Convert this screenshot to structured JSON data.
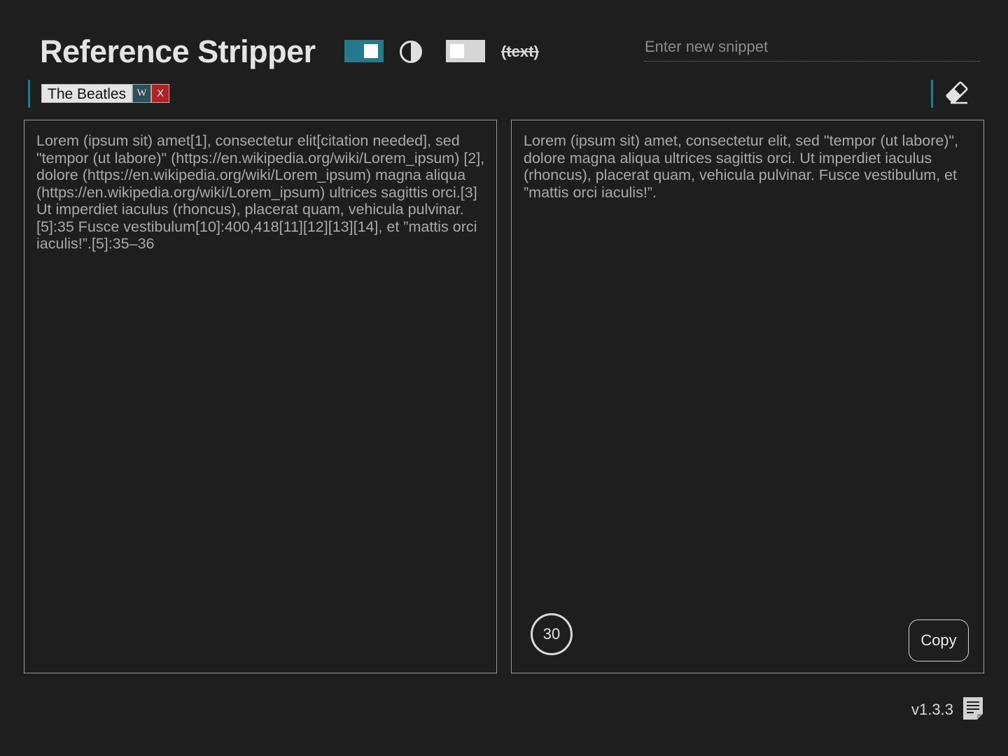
{
  "header": {
    "title": "Reference Stripper",
    "strike_label": "(text)",
    "snippet_placeholder": "Enter new snippet"
  },
  "toggles": {
    "separator_on": true,
    "parentheses_on": false
  },
  "tags": [
    {
      "label": "The Beatles",
      "wiki_label": "W",
      "remove_label": "X"
    }
  ],
  "input_panel": {
    "text": "Lorem (ipsum sit) amet[1], consectetur elit[citation needed], sed \"tempor (ut labore)\" (https://en.wikipedia.org/wiki/Lorem_ipsum) [2], dolore (https://en.wikipedia.org/wiki/Lorem_ipsum) magna aliqua (https://en.wikipedia.org/wiki/Lorem_ipsum) ultrices sagittis orci.[3] Ut imperdiet iaculus (rhoncus), placerat quam, vehicula pulvinar.[5]:35 Fusce vestibulum[10]:400,418[11][12][13][14], et ”mattis orci iaculis!”.[5]:35–36"
  },
  "output_panel": {
    "text": "Lorem (ipsum sit) amet, consectetur elit, sed \"tempor (ut labore)\", dolore magna aliqua ultrices sagittis orci. Ut imperdiet iaculus (rhoncus), placerat quam, vehicula pulvinar. Fusce vestibulum, et ”mattis orci iaculis!”.",
    "counter": "30",
    "copy_label": "Copy"
  },
  "footer": {
    "version": "v1.3.3"
  },
  "icons": {
    "contrast": "contrast-icon",
    "eraser": "eraser-icon",
    "notes": "notes-icon"
  },
  "colors": {
    "background": "#1e1e1e",
    "accent": "#237a8c",
    "remove_red": "#b52020",
    "wiki_teal": "#2e4f57"
  }
}
